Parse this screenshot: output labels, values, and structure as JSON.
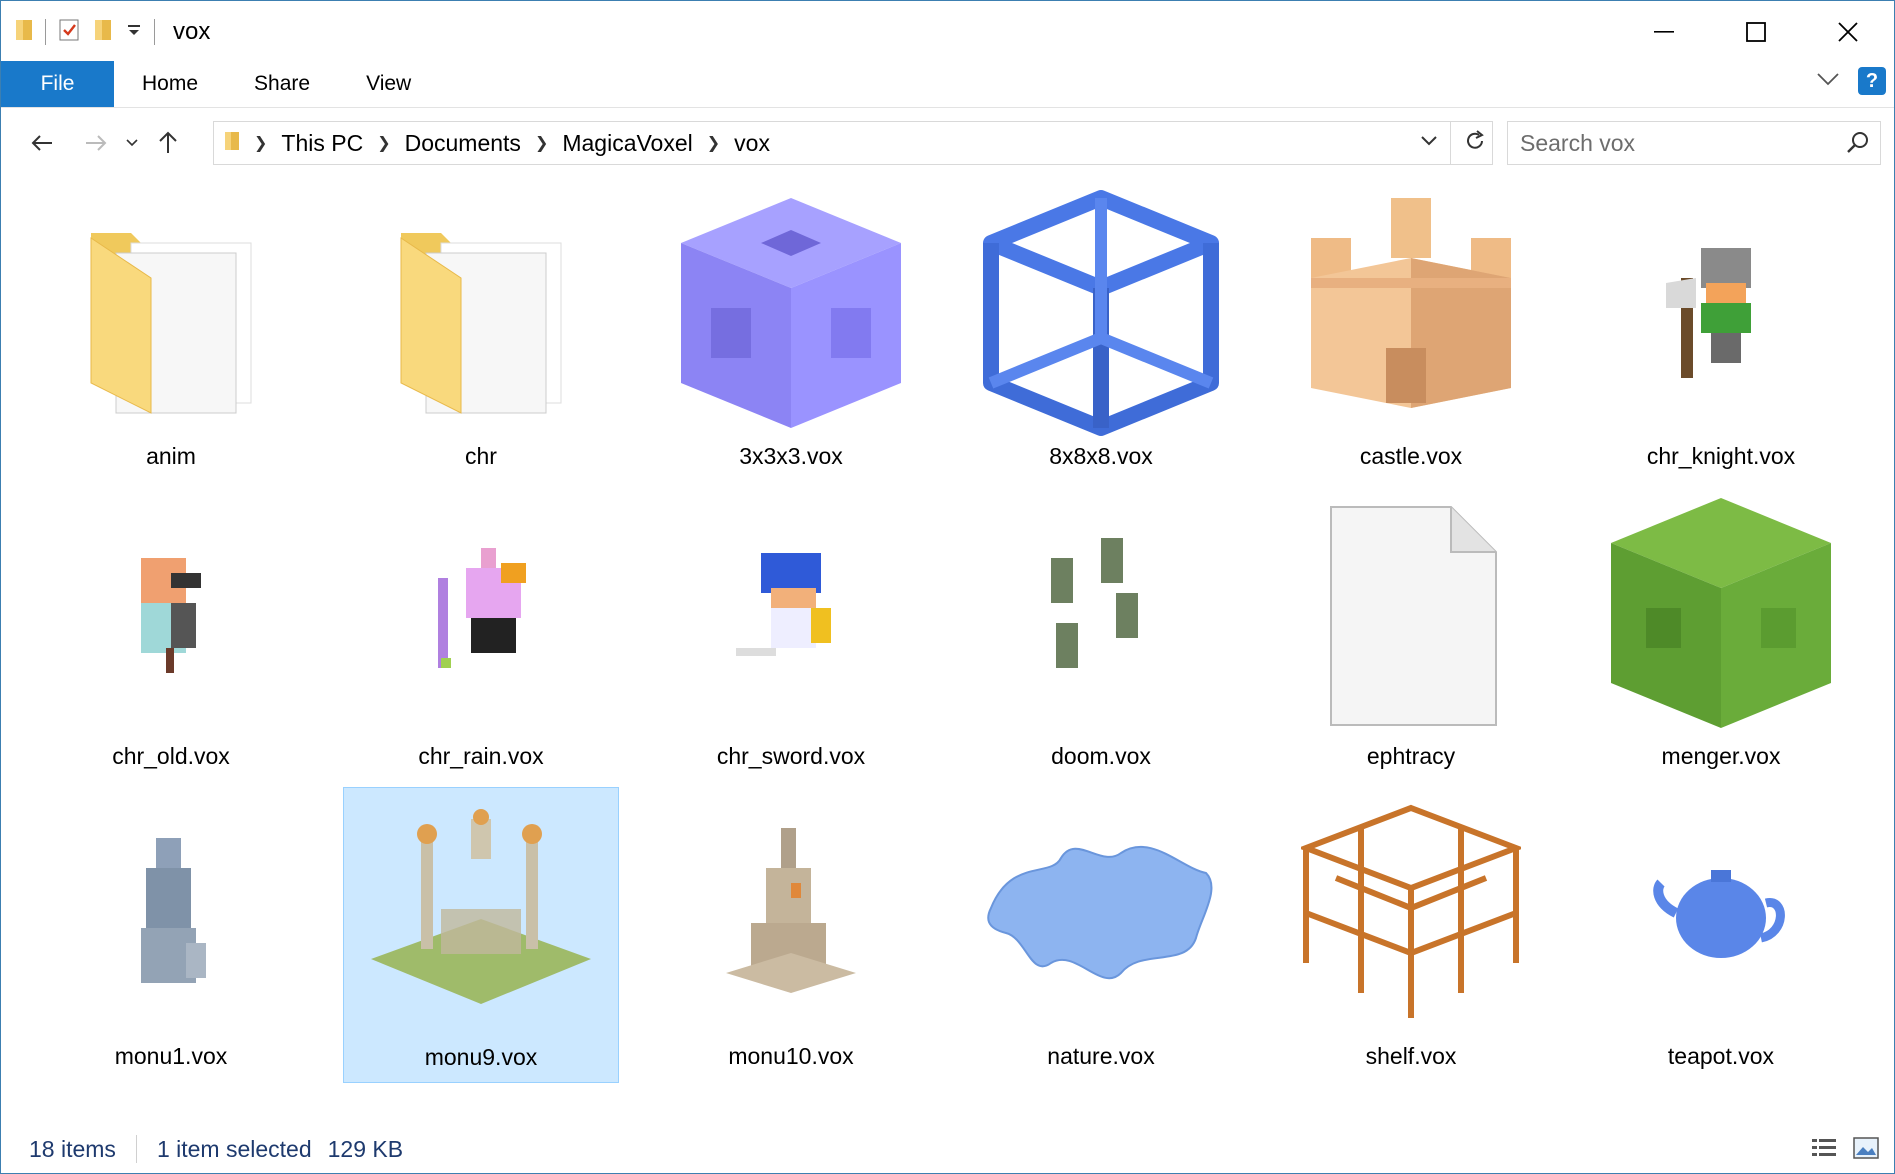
{
  "window": {
    "title": "vox",
    "controls": {
      "minimize": "minimize",
      "maximize": "maximize",
      "close": "close"
    }
  },
  "ribbon": {
    "tabs": [
      "File",
      "Home",
      "Share",
      "View"
    ]
  },
  "address": {
    "crumbs": [
      "This PC",
      "Documents",
      "MagicaVoxel",
      "vox"
    ]
  },
  "search": {
    "placeholder": "Search vox"
  },
  "items": [
    {
      "name": "anim",
      "kind": "folder"
    },
    {
      "name": "chr",
      "kind": "folder"
    },
    {
      "name": "3x3x3.vox",
      "kind": "vox"
    },
    {
      "name": "8x8x8.vox",
      "kind": "vox"
    },
    {
      "name": "castle.vox",
      "kind": "vox"
    },
    {
      "name": "chr_knight.vox",
      "kind": "vox"
    },
    {
      "name": "chr_old.vox",
      "kind": "vox"
    },
    {
      "name": "chr_rain.vox",
      "kind": "vox"
    },
    {
      "name": "chr_sword.vox",
      "kind": "vox"
    },
    {
      "name": "doom.vox",
      "kind": "vox"
    },
    {
      "name": "ephtracy",
      "kind": "file"
    },
    {
      "name": "menger.vox",
      "kind": "vox"
    },
    {
      "name": "monu1.vox",
      "kind": "vox"
    },
    {
      "name": "monu9.vox",
      "kind": "vox",
      "selected": true
    },
    {
      "name": "monu10.vox",
      "kind": "vox"
    },
    {
      "name": "nature.vox",
      "kind": "vox"
    },
    {
      "name": "shelf.vox",
      "kind": "vox"
    },
    {
      "name": "teapot.vox",
      "kind": "vox"
    }
  ],
  "status": {
    "count": "18 items",
    "selection": "1 item selected",
    "size": "129 KB"
  },
  "colors": {
    "accent": "#1979ca",
    "selection_bg": "#cce8ff",
    "selection_border": "#99d1ff"
  }
}
